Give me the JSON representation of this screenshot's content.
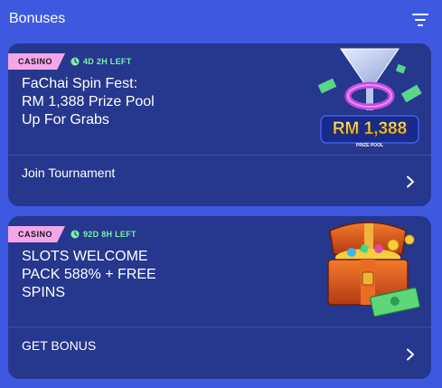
{
  "header": {
    "title": "Bonuses",
    "filter_icon": "filter-lines-icon"
  },
  "cards": [
    {
      "tag": "CASINO",
      "time_left": "4D 2H LEFT",
      "title": "FaChai Spin Fest:\nRM 1,388 Prize Pool\nUp For Grabs",
      "action": "Join Tournament",
      "art_text": "RM 1,388",
      "art_subtext": "PRIZE POOL"
    },
    {
      "tag": "CASINO",
      "time_left": "92D 8H LEFT",
      "title": "SLOTS WELCOME\nPACK 588% + FREE\nSPINS",
      "action": "GET BONUS"
    }
  ],
  "colors": {
    "background": "#3E59E0",
    "card": "#26378E",
    "tag": "#F4A6E8",
    "time": "#7DF2A6"
  }
}
